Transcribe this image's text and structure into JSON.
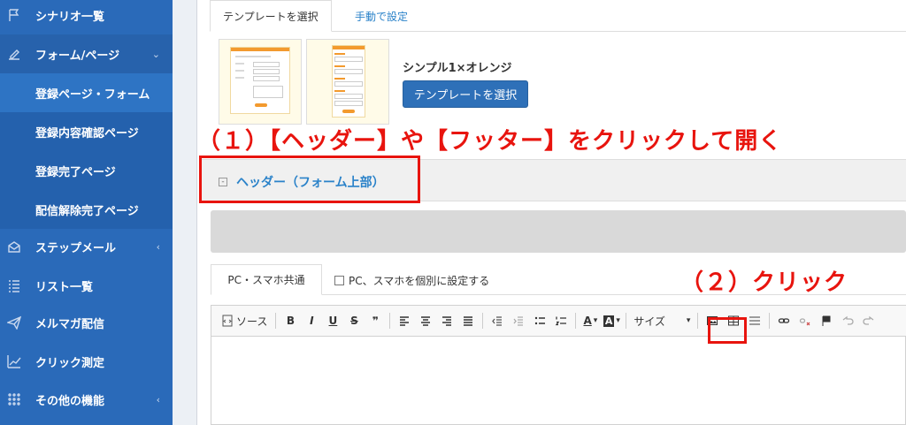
{
  "sidebar": {
    "items": [
      {
        "label": "シナリオ一覧",
        "icon": "flag-icon"
      },
      {
        "label": "フォーム/ページ",
        "icon": "pencil-icon",
        "chevron": "⌄"
      },
      {
        "label": "ステップメール",
        "icon": "envelope-icon",
        "chevron": "‹"
      },
      {
        "label": "リスト一覧",
        "icon": "list-icon"
      },
      {
        "label": "メルマガ配信",
        "icon": "paper-plane-icon"
      },
      {
        "label": "クリック測定",
        "icon": "line-chart-icon"
      },
      {
        "label": "その他の機能",
        "icon": "grid-dots-icon",
        "chevron": "‹"
      }
    ],
    "subitems": [
      {
        "label": "登録ページ・フォーム"
      },
      {
        "label": "登録内容確認ページ"
      },
      {
        "label": "登録完了ページ"
      },
      {
        "label": "配信解除完了ページ"
      }
    ]
  },
  "top_tabs": {
    "select_template": "テンプレートを選択",
    "manual": "手動で設定"
  },
  "template": {
    "name": "シンプル1×オレンジ",
    "select_button": "テンプレートを選択"
  },
  "annotations": {
    "step1": "（１）【ヘッダー】や【フッター】をクリックして開く",
    "step2": "（２）クリック"
  },
  "header_section": {
    "toggle": "-",
    "title": "ヘッダー（フォーム上部）"
  },
  "editor_tabs": {
    "shared": "PC・スマホ共通",
    "separate": "PC、スマホを個別に設定する"
  },
  "toolbar": {
    "source": "ソース",
    "size": "サイズ",
    "size_caret": "▾",
    "bold": "B",
    "italic": "I",
    "underline": "U",
    "strike": "S",
    "quote": "❞",
    "font_color": "A",
    "bg_color": "A",
    "caret": "▾"
  },
  "colors": {
    "sidebar": "#2a6ab9",
    "accent": "#2a82c9",
    "annotation": "#e8140e",
    "button": "#2e70b8"
  }
}
